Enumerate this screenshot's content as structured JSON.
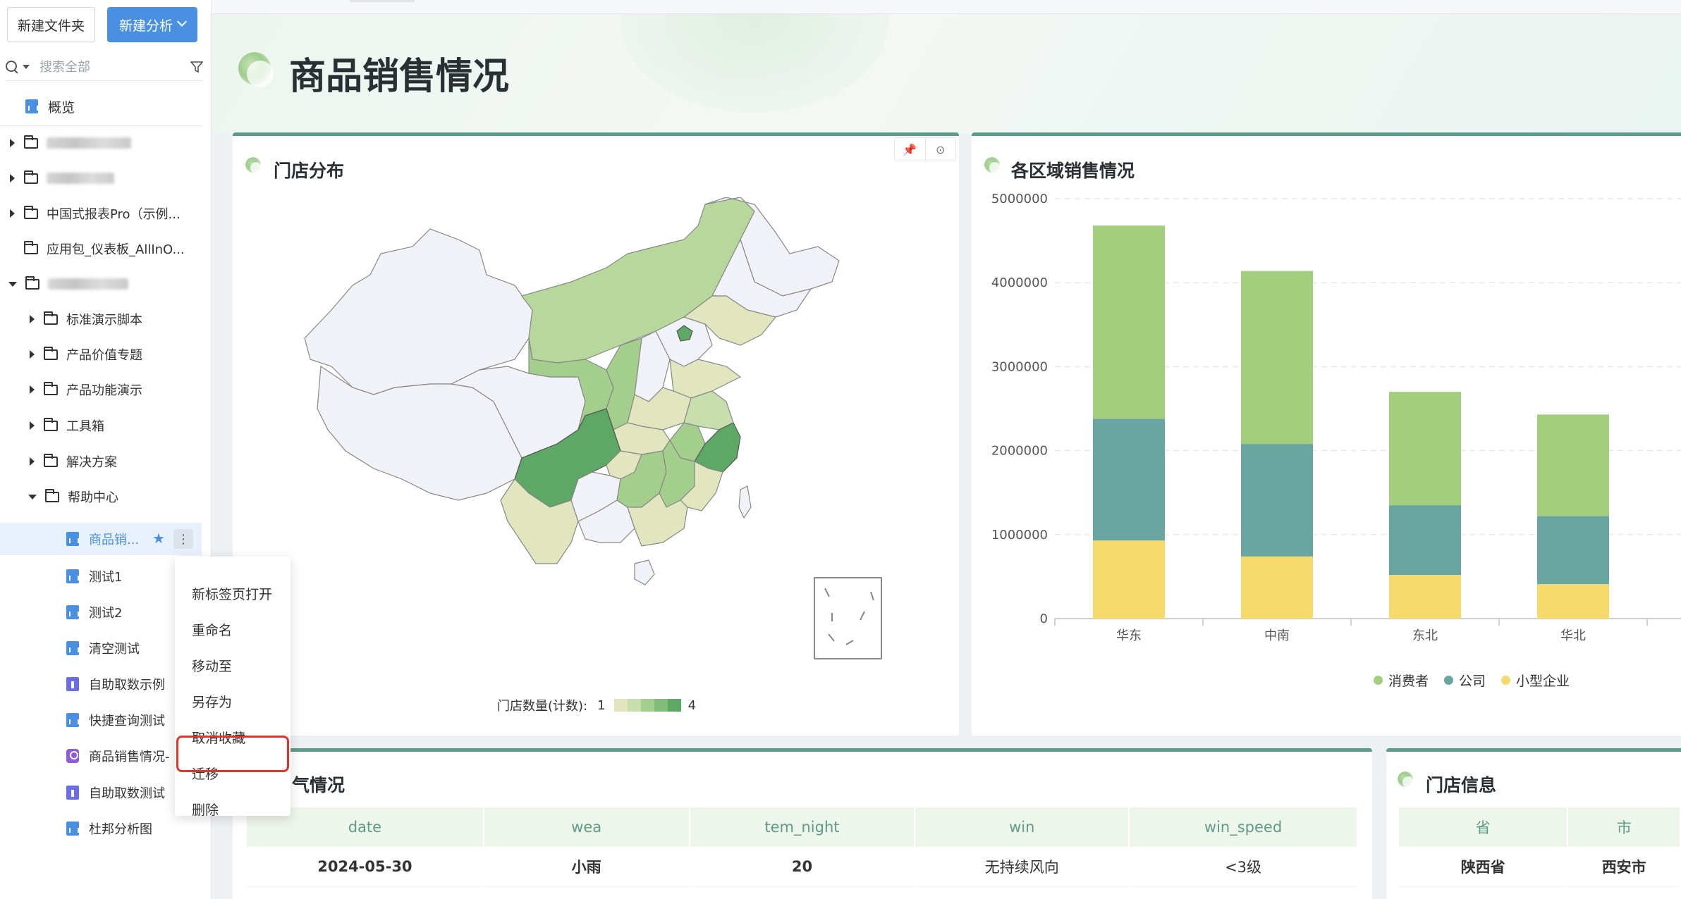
{
  "sidebar": {
    "new_folder": "新建文件夹",
    "new_analysis": "新建分析",
    "search_placeholder": "搜索全部",
    "overview": "概览",
    "folders": {
      "china_report": "中国式报表Pro（示例...",
      "app_package": "应用包_仪表板_AllInO...",
      "standard_demo": "标准演示脚本",
      "product_value": "产品价值专题",
      "product_features": "产品功能演示",
      "toolbox": "工具箱",
      "solutions": "解决方案",
      "help_center": "帮助中心"
    },
    "docs": {
      "current": "商品销...",
      "test1": "测试1",
      "test2": "测试2",
      "clear_test": "清空测试",
      "self_fetch_example": "自助取数示例",
      "quick_query_test": "快捷查询测试",
      "sales_situation": "商品销售情况-",
      "self_fetch_test": "自助取数测试",
      "dupont": "杜邦分析图"
    }
  },
  "context_menu": {
    "open_new_tab": "新标签页打开",
    "rename": "重命名",
    "move_to": "移动至",
    "save_as": "另存为",
    "unfavorite": "取消收藏",
    "migrate": "迁移",
    "delete": "删除"
  },
  "page_title": "商品销售情况",
  "map_card": {
    "title": "门店分布",
    "legend_label": "门店数量(计数):",
    "legend_min": "1",
    "legend_max": "4",
    "legend_colors": [
      "#e2e6bf",
      "#c6dfac",
      "#a3ce8c",
      "#82bd77",
      "#5ea866"
    ]
  },
  "bar_card": {
    "title": "各区域销售情况"
  },
  "chart_data": {
    "type": "bar",
    "stacked": true,
    "categories": [
      "华东",
      "中南",
      "东北",
      "华北"
    ],
    "series": [
      {
        "name": "小型企业",
        "color": "#f6d96b",
        "values": [
          930000,
          740000,
          520000,
          410000
        ]
      },
      {
        "name": "公司",
        "color": "#6aa6a0",
        "values": [
          1450000,
          1340000,
          830000,
          810000
        ]
      },
      {
        "name": "消费者",
        "color": "#a3ce7d",
        "values": [
          2300000,
          2060000,
          1350000,
          1210000
        ]
      }
    ],
    "yticks": [
      "0",
      "1000000",
      "2000000",
      "3000000",
      "4000000",
      "5000000"
    ],
    "ylim": [
      0,
      5000000
    ],
    "legend": [
      "消费者",
      "公司",
      "小型企业"
    ],
    "legend_position": "bottom"
  },
  "weather_card": {
    "title": "气情况",
    "columns": [
      "date",
      "wea",
      "tem_night",
      "win",
      "win_speed"
    ],
    "rows": [
      [
        "2024-05-30",
        "小雨",
        "20",
        "无持续风向",
        "<3级"
      ]
    ]
  },
  "store_card": {
    "title": "门店信息",
    "columns": [
      "省",
      "市"
    ],
    "rows": [
      [
        "陕西省",
        "西安市"
      ]
    ]
  }
}
